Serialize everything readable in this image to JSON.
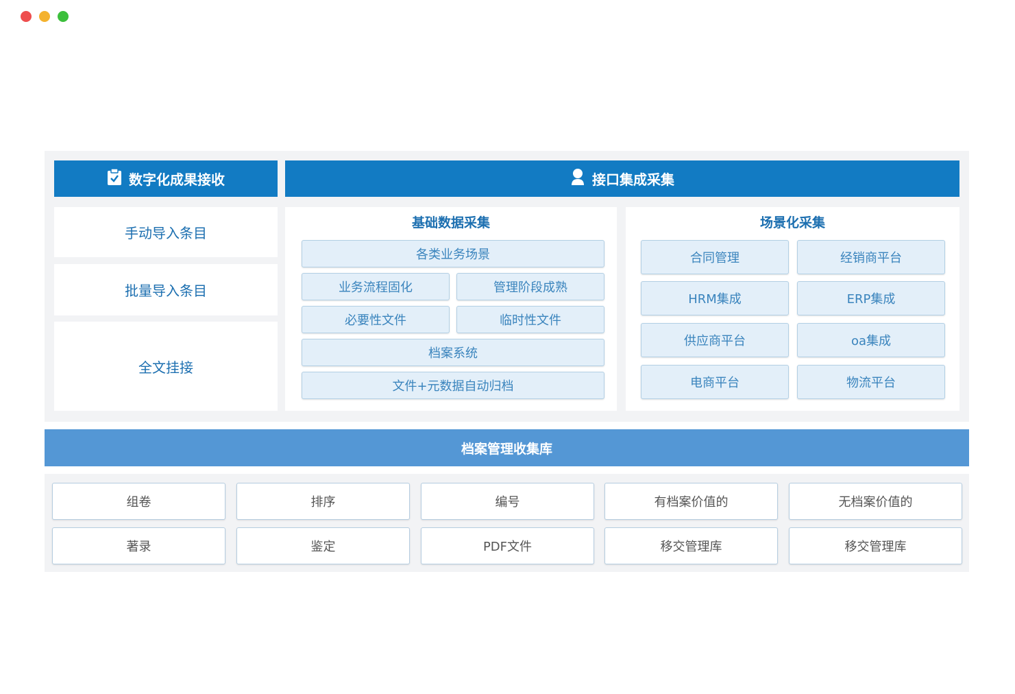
{
  "left_header": {
    "title": "数字化成果接收",
    "icon": "clipboard-check-icon"
  },
  "right_header": {
    "title": "接口集成采集",
    "icon": "user-icon"
  },
  "left_items": [
    "手动导入条目",
    "批量导入条目",
    "全文挂接"
  ],
  "basic": {
    "title": "基础数据采集",
    "items": [
      "各类业务场景",
      "业务流程固化",
      "管理阶段成熟",
      "必要性文件",
      "临时性文件",
      "档案系统",
      "文件+元数据自动归档"
    ]
  },
  "scenario": {
    "title": "场景化采集",
    "items": [
      "合同管理",
      "经销商平台",
      "HRM集成",
      "ERP集成",
      "供应商平台",
      "oa集成",
      "电商平台",
      "物流平台"
    ]
  },
  "library": {
    "title": "档案管理收集库"
  },
  "bottom": {
    "row1": [
      "组卷",
      "排序",
      "编号",
      "有档案价值的",
      "无档案价值的"
    ],
    "row2": [
      "著录",
      "鉴定",
      "PDF文件",
      "移交管理库",
      "移交管理库"
    ]
  },
  "colors": {
    "header_blue": "#127bc3",
    "library_blue": "#5497d5",
    "panel_bg": "#f2f3f5",
    "box_bg": "#e3eff9"
  }
}
